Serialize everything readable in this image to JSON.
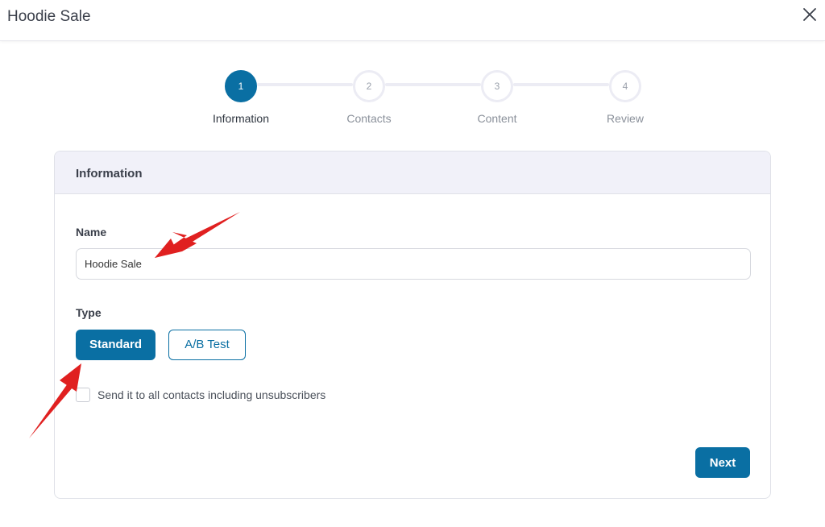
{
  "modal": {
    "title": "Hoodie Sale",
    "close_icon": "close-icon"
  },
  "stepper": {
    "steps": [
      {
        "number": "1",
        "label": "Information",
        "active": true
      },
      {
        "number": "2",
        "label": "Contacts",
        "active": false
      },
      {
        "number": "3",
        "label": "Content",
        "active": false
      },
      {
        "number": "4",
        "label": "Review",
        "active": false
      }
    ]
  },
  "card": {
    "header": "Information",
    "name_label": "Name",
    "name_value": "Hoodie Sale",
    "type_label": "Type",
    "type_options": [
      "Standard",
      "A/B Test"
    ],
    "selected_type": "Standard",
    "checkbox_label": "Send it to all contacts including unsubscribers",
    "checkbox_checked": false,
    "next_label": "Next"
  },
  "colors": {
    "accent": "#0a6fa3",
    "annotation_arrow": "#e02020"
  }
}
